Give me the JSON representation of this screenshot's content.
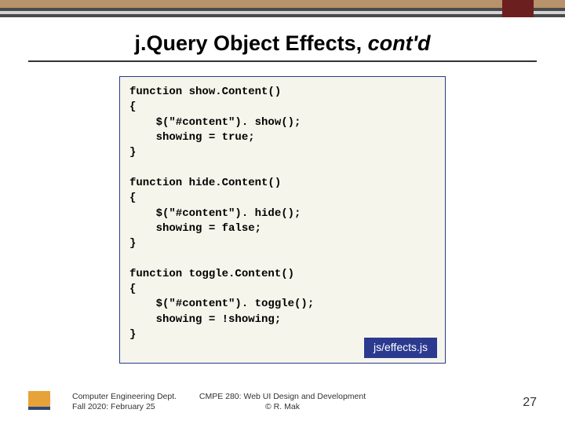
{
  "title_main": "j.Query Object Effects, ",
  "title_italic": "cont'd",
  "code": "function show.Content()\n{\n    $(\"#content\"). show();\n    showing = true;\n}\n\nfunction hide.Content()\n{\n    $(\"#content\"). hide();\n    showing = false;\n}\n\nfunction toggle.Content()\n{\n    $(\"#content\"). toggle();\n    showing = !showing;\n}",
  "file_label": "js/effects.js",
  "footer_left_line1": "Computer Engineering Dept.",
  "footer_left_line2": "Fall 2020: February 25",
  "footer_center_line1": "CMPE 280: Web UI Design and Development",
  "footer_center_line2": "© R. Mak",
  "page_number": "27"
}
